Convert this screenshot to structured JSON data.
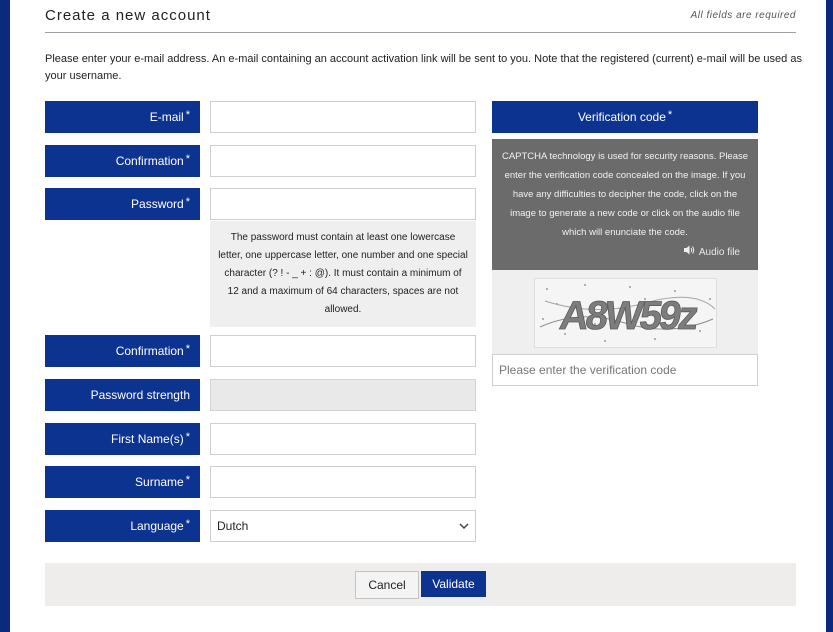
{
  "header": {
    "title": "Create a new account",
    "note": "All fields are required"
  },
  "intro": "Please enter your e-mail address. An e-mail containing an account activation link will be sent to you. Note that the registered (current) e-mail will be used as your username.",
  "required_marker": "*",
  "form": {
    "email": {
      "label": "E-mail",
      "value": ""
    },
    "email_confirm": {
      "label": "Confirmation",
      "value": ""
    },
    "password": {
      "label": "Password",
      "value": ""
    },
    "password_hint": "The password must contain at least one lowercase letter, one uppercase letter, one number and one special character (? ! - _ + : @). It must contain a minimum of 12 and a maximum of 64 characters, spaces are not allowed.",
    "password_confirm": {
      "label": "Confirmation",
      "value": ""
    },
    "password_strength": {
      "label": "Password strength",
      "value": ""
    },
    "first_name": {
      "label": "First Name(s)",
      "value": ""
    },
    "surname": {
      "label": "Surname",
      "value": ""
    },
    "language": {
      "label": "Language",
      "value": "Dutch"
    }
  },
  "verification": {
    "title": "Verification code",
    "info": "CAPTCHA technology is used for security reasons. Please enter the verification code concealed on the image. If you have any difficulties to decipher the code, click on the image to generate a new code or click on the audio file which will enunciate the code.",
    "audio_icon": "speaker-icon",
    "audio_label": "Audio file",
    "captcha_text": "A8W59z",
    "input_placeholder": "Please enter the verification code",
    "input_value": ""
  },
  "actions": {
    "cancel_label": "Cancel",
    "validate_label": "Validate"
  },
  "colors": {
    "brand": "#0d3391",
    "frame": "#0d2a7a",
    "captcha_panel": "#6b6b6b"
  }
}
